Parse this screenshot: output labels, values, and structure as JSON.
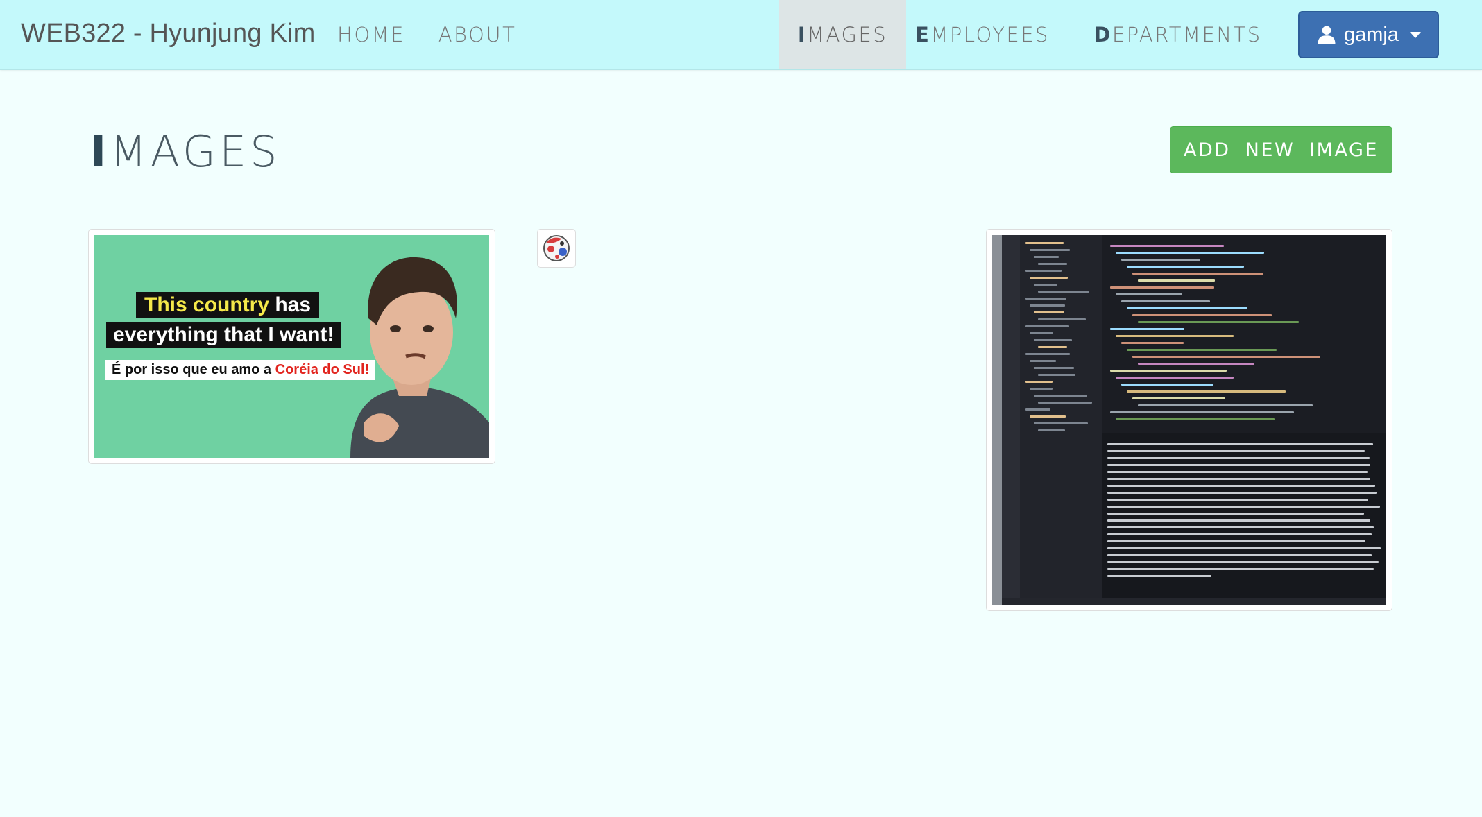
{
  "navbar": {
    "brand": "WEB322 - Hyunjung Kim",
    "links": [
      {
        "first": "H",
        "rest": "OME"
      },
      {
        "first": "A",
        "rest": "BOUT"
      },
      {
        "first": "I",
        "rest": "MAGES"
      },
      {
        "first": "E",
        "rest": "MPLOYEES"
      },
      {
        "first": "D",
        "rest": "EPARTMENTS"
      }
    ],
    "active_link": "IMAGES",
    "user": "gamja"
  },
  "page": {
    "title_first": "I",
    "title_rest": "MAGES",
    "add_button": "ADD NEW IMAGE"
  },
  "images": [
    {
      "name": "youtube-thumbnail",
      "line1_highlight": "This country",
      "line1_rest": " has",
      "line2": "everything that I want!",
      "line3_prefix": "É por isso que eu amo a ",
      "line3_red": "Coréia do Sul!"
    },
    {
      "name": "small-icon-image"
    },
    {
      "name": "code-editor-screenshot"
    }
  ],
  "colors": {
    "navbar_bg": "#c4f9fb",
    "page_bg": "#f2fffe",
    "user_button": "#3d70b2",
    "add_button": "#5cb85c",
    "active_nav_bg": "#dde5e6"
  }
}
